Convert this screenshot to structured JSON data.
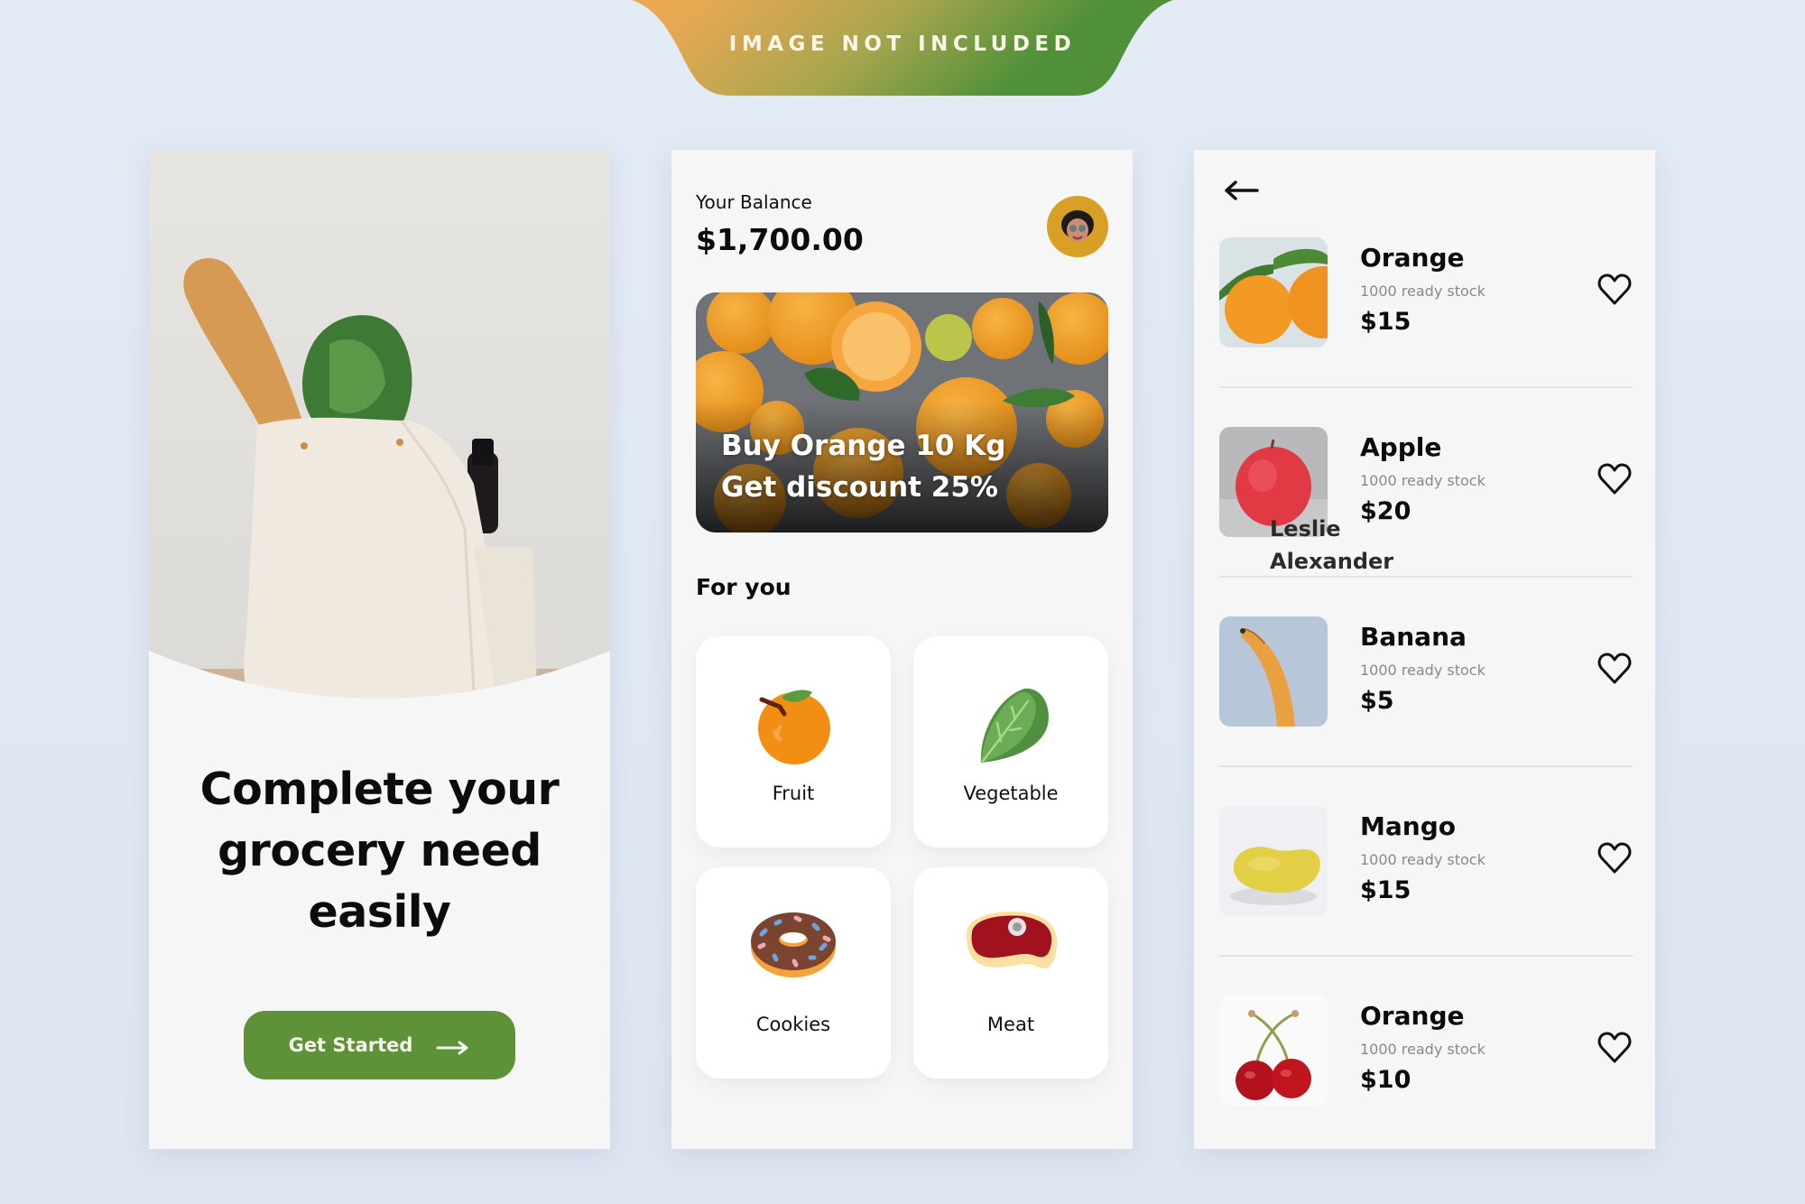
{
  "banner": {
    "text": "IMAGE NOT INCLUDED",
    "gradient_start": "#e9a852",
    "gradient_end": "#4d8f38"
  },
  "onboarding": {
    "headline_lines": [
      "Complete your",
      "grocery need",
      "easily"
    ],
    "cta_label": "Get Started",
    "cta_icon": "arrow-right-icon",
    "accent_color": "#5f9139",
    "hero_image": "grocery-bag-photo"
  },
  "home": {
    "balance_label": "Your Balance",
    "balance_value": "$1,700.00",
    "avatar": "user-avatar",
    "promo": {
      "line1": "Buy Orange 10 Kg",
      "line2": "Get discount 25%",
      "image": "oranges-photo"
    },
    "section_title": "For you",
    "categories": [
      {
        "label": "Fruit",
        "icon": "orange-icon"
      },
      {
        "label": "Vegetable",
        "icon": "lettuce-icon"
      },
      {
        "label": "Cookies",
        "icon": "donut-icon"
      },
      {
        "label": "Meat",
        "icon": "steak-icon"
      }
    ]
  },
  "list": {
    "back_icon": "arrow-left-icon",
    "products": [
      {
        "name": "Orange",
        "stock": "1000 ready stock",
        "price": "$15",
        "image": "orange-photo"
      },
      {
        "name": "Apple",
        "stock": "1000 ready stock",
        "price": "$20",
        "image": "apple-photo"
      },
      {
        "name": "Banana",
        "stock": "1000 ready stock",
        "price": "$5",
        "image": "banana-photo"
      },
      {
        "name": "Mango",
        "stock": "1000 ready stock",
        "price": "$15",
        "image": "mango-photo"
      },
      {
        "name": "Orange",
        "stock": "1000 ready stock",
        "price": "$10",
        "image": "cherries-photo"
      }
    ],
    "overlay_text": [
      "Leslie",
      "Alexander"
    ]
  }
}
